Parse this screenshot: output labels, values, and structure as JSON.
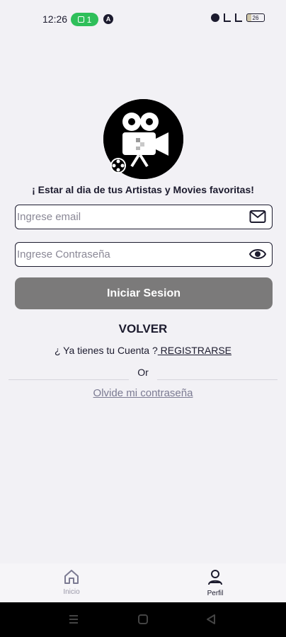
{
  "status_bar": {
    "time": "12:26",
    "pill_count": "1",
    "battery": "26"
  },
  "login": {
    "tagline": "¡ Estar al dia de tus Artistas y Movies favoritas!",
    "email_placeholder": "Ingrese email",
    "password_placeholder": "Ingrese Contraseña",
    "login_button": "Iniciar Sesion",
    "back_label": "VOLVER",
    "register_prompt": "¿ Ya tienes tu Cuenta  ?",
    "register_link": " REGISTRARSE",
    "or_label": "Or",
    "forgot_link": "Olvide mi contraseña"
  },
  "bottom_nav": {
    "items": [
      {
        "label": "Inicio"
      },
      {
        "label": "Perfil"
      }
    ]
  },
  "icons": {
    "email": "mail-icon",
    "password": "eye-icon",
    "home": "home-icon",
    "profile": "user-icon",
    "logo": "movie-camera-icon"
  },
  "colors": {
    "button_gray": "#7b7a7a",
    "accent_dark": "#1c1b2e",
    "link_muted": "#7b7a92",
    "status_green": "#2fbf5a"
  }
}
